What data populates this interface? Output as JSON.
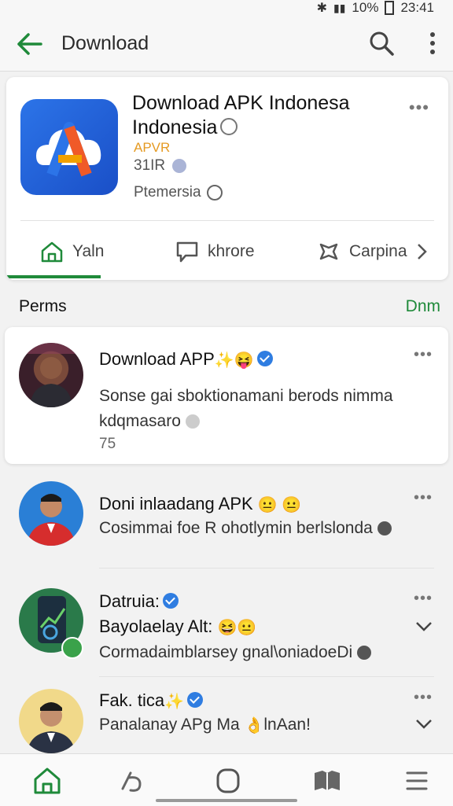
{
  "status": {
    "time": "23:41",
    "battery": "10%"
  },
  "topbar": {
    "title": "Download"
  },
  "app": {
    "title": "Download APK Indonesa Indonesia",
    "developer": "APVR",
    "size": "31IR",
    "category": "Ptemersia"
  },
  "tabs": [
    {
      "label": "Yaln"
    },
    {
      "label": "khrore"
    },
    {
      "label": "Carpina"
    }
  ],
  "section": {
    "title": "Perms",
    "link": "Dnm"
  },
  "posts": [
    {
      "name": "Download APP",
      "line1": "Sonse gai sboktionamani berods nimma",
      "line2": "kdqmasaro",
      "count": "75"
    },
    {
      "name": "Doni inlaadang APK",
      "line1": "Cosimmai foe R ohotlymin berlslonda"
    },
    {
      "name": "Datruia:",
      "line1": "Bayolaelay Alt:",
      "line2": "Cormadaimblarsey gnal\\oniadoeDi"
    },
    {
      "name": "Fak. tica",
      "line1": "Panalanay APg Ma",
      "line1b": "lnAan!"
    }
  ],
  "colors": {
    "accent": "#1f8a3a",
    "app_icon": "#2c74e8",
    "verified": "#2f7de1"
  }
}
